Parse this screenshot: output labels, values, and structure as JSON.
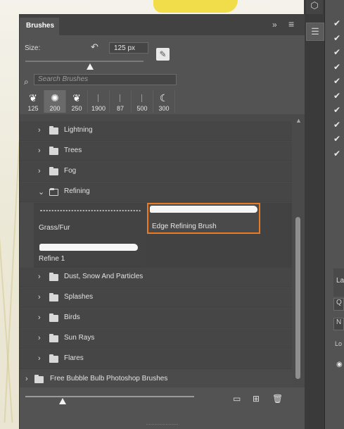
{
  "panel": {
    "tab_label": "Brushes",
    "collapse_glyph": "»",
    "menu_glyph": "≡"
  },
  "size": {
    "label": "Size:",
    "value": "125 px",
    "slider_fraction": 0.55
  },
  "search": {
    "placeholder": "Search Brushes"
  },
  "presets": [
    {
      "size": "125",
      "tip": "splash-icon"
    },
    {
      "size": "200",
      "tip": "scatter-icon",
      "selected": true
    },
    {
      "size": "250",
      "tip": "splash-icon"
    },
    {
      "size": "1900",
      "tip": "line-icon"
    },
    {
      "size": "87",
      "tip": "line-icon"
    },
    {
      "size": "500",
      "tip": "line-icon"
    },
    {
      "size": "300",
      "tip": "crescent-icon"
    }
  ],
  "folders_top": [
    {
      "label": "Lightning"
    },
    {
      "label": "Trees"
    },
    {
      "label": "Fog"
    }
  ],
  "open_folder": {
    "label": "Refining",
    "brushes": [
      {
        "name": "Grass/Fur",
        "selected": false
      },
      {
        "name": "Edge Refining Brush",
        "selected": true
      },
      {
        "name": "Refine 1",
        "selected": false
      }
    ]
  },
  "folders_bottom": [
    {
      "label": "Dust, Snow And Particles"
    },
    {
      "label": "Splashes"
    },
    {
      "label": "Birds"
    },
    {
      "label": "Sun Rays"
    },
    {
      "label": "Flares"
    }
  ],
  "group": {
    "label": "Free Bubble Bulb Photoshop Brushes"
  },
  "bottom_toolbar": {
    "preview_slider_fraction": 0.22,
    "icons": [
      "folder-icon",
      "new-brush-icon",
      "trash-icon"
    ]
  },
  "right_panel": {
    "layers_label": "La",
    "lock_label": "Lo",
    "checkmark_count": 10
  },
  "accent_color": "#e87b24"
}
